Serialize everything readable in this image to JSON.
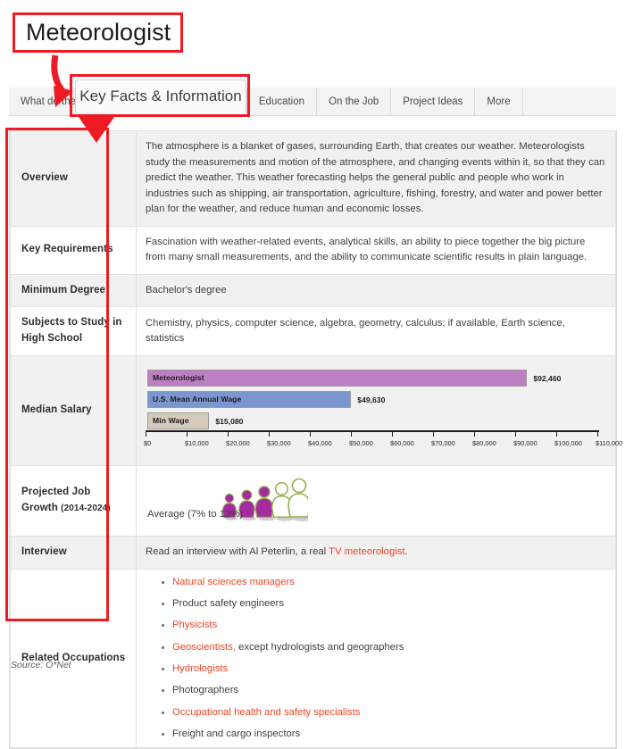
{
  "annotations": {
    "title_callout": "Meteorologist",
    "tab_callout": "Key Facts & Information",
    "accent_color": "#ed1c24"
  },
  "tabs": [
    {
      "label": "What do they do?",
      "active": false
    },
    {
      "label": "Key Facts & Information",
      "active": true
    },
    {
      "label": "Education",
      "active": false
    },
    {
      "label": "On the Job",
      "active": false
    },
    {
      "label": "Project Ideas",
      "active": false
    },
    {
      "label": "More",
      "active": false
    }
  ],
  "rows": {
    "overview": {
      "label": "Overview",
      "text": "The atmosphere is a blanket of gases, surrounding Earth, that creates our weather. Meteorologists study the measurements and motion of the atmosphere, and changing events within it, so that they can predict the weather. This weather forecasting helps the general public and people who work in industries such as shipping, air transportation, agriculture, fishing, forestry, and water and power better plan for the weather, and reduce human and economic losses."
    },
    "key_requirements": {
      "label": "Key Requirements",
      "text": "Fascination with weather-related events, analytical skills, an ability to piece together the big picture from many small measurements, and the ability to communicate scientific results in plain language."
    },
    "minimum_degree": {
      "label": "Minimum Degree",
      "text": "Bachelor's degree"
    },
    "subjects": {
      "label": "Subjects to Study in High School",
      "text": "Chemistry, physics, computer science, algebra, geometry, calculus; if available, Earth science, statistics"
    },
    "median_salary": {
      "label": "Median Salary"
    },
    "job_growth": {
      "label_main": "Projected Job Growth",
      "label_years": "(2014-2024)",
      "text": "Average (7% to 13%)"
    },
    "interview": {
      "label": "Interview",
      "text_before": "Read an interview with Al Peterlin, a real ",
      "link": "TV meteorologist",
      "text_after": "."
    },
    "related": {
      "label": "Related Occupations",
      "items": [
        {
          "text": "Natural sciences managers",
          "link": true,
          "suffix": ""
        },
        {
          "text": "Product safety engineers",
          "link": false,
          "suffix": ""
        },
        {
          "text": "Physicists",
          "link": true,
          "suffix": ""
        },
        {
          "text": "Geoscientists,",
          "link": true,
          "suffix": " except hydrologists and geographers"
        },
        {
          "text": "Hydrologists",
          "link": true,
          "suffix": ""
        },
        {
          "text": "Photographers",
          "link": false,
          "suffix": ""
        },
        {
          "text": "Occupational health and safety specialists",
          "link": true,
          "suffix": ""
        },
        {
          "text": "Freight and cargo inspectors",
          "link": false,
          "suffix": ""
        }
      ]
    }
  },
  "footer": {
    "source": "Source: O*Net"
  },
  "chart_data": {
    "type": "bar",
    "orientation": "horizontal",
    "title": "",
    "xlabel": "",
    "ylabel": "",
    "xlim": [
      0,
      110000
    ],
    "grid": false,
    "legend": false,
    "categories": [
      "Meteorologist",
      "U.S. Mean Annual Wage",
      "Min Wage"
    ],
    "values": [
      92460,
      49630,
      15080
    ],
    "value_labels": [
      "$92,460",
      "$49,630",
      "$15,080"
    ],
    "colors": [
      "#bd7fc4",
      "#7b95cf",
      "#d4cbbd"
    ],
    "tick_values": [
      0,
      10000,
      20000,
      30000,
      40000,
      50000,
      60000,
      70000,
      80000,
      90000,
      100000,
      110000
    ],
    "tick_labels": [
      "$0",
      "$10,000",
      "$20,000",
      "$30,000",
      "$40,000",
      "$50,000",
      "$60,000",
      "$70,000",
      "$80,000",
      "$90,000",
      "$100,000",
      "$110,000"
    ]
  },
  "growth_figures": {
    "total": 5,
    "filled": 3,
    "fill_color": "#a62ba0",
    "empty_color": "#ffffff"
  }
}
